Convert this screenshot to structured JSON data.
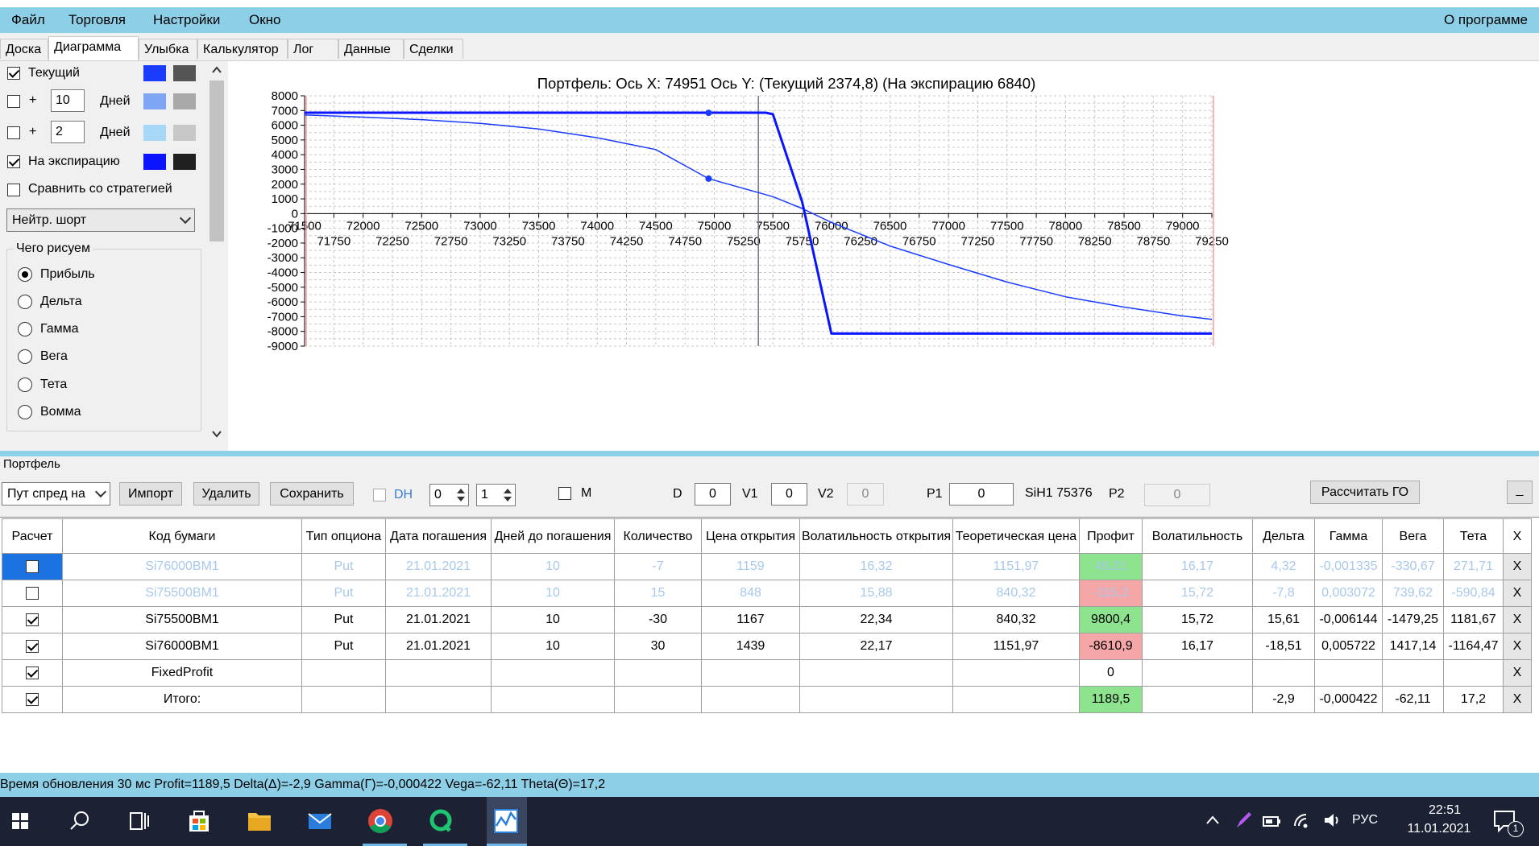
{
  "menu": {
    "items": [
      "Файл",
      "Торговля",
      "Настройки",
      "Окно"
    ],
    "about": "О программе"
  },
  "tabs": [
    "Доска",
    "Диаграмма",
    "Улыбка",
    "Калькулятор",
    "Лог",
    "Данные",
    "Сделки"
  ],
  "left_panel": {
    "current_label": "Текущий",
    "plus": "+",
    "days_label": "Дней",
    "days1": "10",
    "days2": "2",
    "expiry_label": "На экспирацию",
    "compare_label": "Сравнить со стратегией",
    "strategy_select": "Нейтр. шорт",
    "draw_group": "Чего рисуем",
    "radios": [
      "Прибыль",
      "Дельта",
      "Гамма",
      "Вега",
      "Тета",
      "Вомма"
    ],
    "colors": {
      "current_main": "#1a3cff",
      "current_alt": "#555555",
      "d10_main": "#7fa6f2",
      "d10_alt": "#a8a8a8",
      "d2_main": "#a8d8f8",
      "d2_alt": "#c8c8c8",
      "expiry_main": "#0a14ff",
      "expiry_alt": "#202020"
    }
  },
  "portfolio": {
    "section_label": "Портфель",
    "select_value": "Пут спред на",
    "import_btn": "Импорт",
    "delete_btn": "Удалить",
    "save_btn": "Сохранить",
    "dh_label": "DH",
    "spin1": "0",
    "spin2": "1",
    "m_label": "M",
    "d_label": "D",
    "d_value": "0",
    "v1_label": "V1",
    "v1_value": "0",
    "v2_label": "V2",
    "v2_value": "0",
    "p1_label": "P1",
    "p1_value": "0",
    "instrument": "SiH1 75376",
    "p2_label": "P2",
    "p2_value": "0",
    "calc_btn": "Рассчитать ГО",
    "min_btn": "_"
  },
  "table": {
    "headers": [
      "Расчет",
      "Код бумаги",
      "Тип опциона",
      "Дата погашения",
      "Дней до погашения",
      "Количество",
      "Цена открытия",
      "Волатильность открытия",
      "Теоретическая цена",
      "Профит",
      "Волатильность",
      "Дельта",
      "Гамма",
      "Вега",
      "Тета",
      "X"
    ],
    "rows": [
      {
        "check": true,
        "sel": true,
        "faded": true,
        "cells": [
          "Si76000BM1",
          "Put",
          "21.01.2021",
          "10",
          "-7",
          "1159",
          "16,32",
          "1151,97",
          "49,21",
          "16,17",
          "4,32",
          "-0,001335",
          "-330,67",
          "271,71",
          "X"
        ],
        "profit_color": "#8ee38e"
      },
      {
        "check": false,
        "sel": false,
        "faded": true,
        "cells": [
          "Si75500BM1",
          "Put",
          "21.01.2021",
          "10",
          "15",
          "848",
          "15,88",
          "840,32",
          "-115,2",
          "15,72",
          "-7,8",
          "0,003072",
          "739,62",
          "-590,84",
          "X"
        ],
        "profit_color": "#f5a6a6"
      },
      {
        "check": true,
        "sel": false,
        "faded": false,
        "cells": [
          "Si75500BM1",
          "Put",
          "21.01.2021",
          "10",
          "-30",
          "1167",
          "22,34",
          "840,32",
          "9800,4",
          "15,72",
          "15,61",
          "-0,006144",
          "-1479,25",
          "1181,67",
          "X"
        ],
        "profit_color": "#8ee38e"
      },
      {
        "check": true,
        "sel": false,
        "faded": false,
        "cells": [
          "Si76000BM1",
          "Put",
          "21.01.2021",
          "10",
          "30",
          "1439",
          "22,17",
          "1151,97",
          "-8610,9",
          "16,17",
          "-18,51",
          "0,005722",
          "1417,14",
          "-1164,47",
          "X"
        ],
        "profit_color": "#f5a6a6"
      },
      {
        "check": true,
        "sel": false,
        "faded": false,
        "cells": [
          "FixedProfit",
          "",
          "",
          "",
          "",
          "",
          "",
          "",
          "0",
          "",
          "",
          "",
          "",
          "",
          "X"
        ],
        "profit_color": "#ffffff"
      },
      {
        "check": true,
        "sel": false,
        "faded": false,
        "cells": [
          "Итого:",
          "",
          "",
          "",
          "",
          "",
          "",
          "",
          "1189,5",
          "",
          "-2,9",
          "-0,000422",
          "-62,11",
          "17,2",
          "X"
        ],
        "profit_color": "#8ee38e"
      }
    ]
  },
  "status": {
    "text": "Время обновления 30 мс  Profit=1189,5 Delta(Δ)=-2,9 Gamma(Γ)=-0,000422 Vega=-62,11 Theta(Θ)=17,2"
  },
  "taskbar": {
    "lang": "РУС",
    "time": "22:51",
    "date": "11.01.2021",
    "notif_count": "1"
  },
  "chart_data": {
    "type": "line",
    "title": "Портфель: Ось X: 74951 Ось Y:  (Текущий 2374,8)  (На экспирацию 6840)",
    "xlim": [
      71500,
      79250
    ],
    "ylim": [
      -9000,
      8000
    ],
    "x_ticks_top": [
      71500,
      72000,
      72500,
      73000,
      73500,
      74000,
      74500,
      75000,
      75500,
      76000,
      76500,
      77000,
      77500,
      78000,
      78500,
      79000
    ],
    "x_ticks_bottom": [
      71750,
      72250,
      72750,
      73250,
      73750,
      74250,
      74750,
      75250,
      75750,
      76250,
      76750,
      77250,
      77750,
      78250,
      78750,
      79250
    ],
    "y_ticks": [
      8000,
      7000,
      6000,
      5000,
      4000,
      3000,
      2000,
      1000,
      0,
      -1000,
      -2000,
      -3000,
      -4000,
      -5000,
      -6000,
      -7000,
      -8000,
      -9000
    ],
    "grid": true,
    "crosshair_x": 74951,
    "current_price_line": 75376,
    "range_lines": [
      71500,
      79250
    ],
    "series": [
      {
        "name": "Текущий",
        "color": "#1a3cff",
        "width": 1.5,
        "points": [
          [
            71500,
            6700
          ],
          [
            72000,
            6550
          ],
          [
            72500,
            6380
          ],
          [
            73000,
            6130
          ],
          [
            73500,
            5750
          ],
          [
            74000,
            5150
          ],
          [
            74500,
            4350
          ],
          [
            74951,
            2374.8
          ],
          [
            75500,
            1150
          ],
          [
            75750,
            350
          ],
          [
            76000,
            -600
          ],
          [
            76500,
            -2200
          ],
          [
            77000,
            -3450
          ],
          [
            77500,
            -4650
          ],
          [
            78000,
            -5650
          ],
          [
            78500,
            -6350
          ],
          [
            79000,
            -6950
          ],
          [
            79250,
            -7180
          ]
        ]
      },
      {
        "name": "На экспирацию",
        "color": "#0a14ff",
        "width": 3,
        "points": [
          [
            71500,
            6850
          ],
          [
            75440,
            6850
          ],
          [
            75500,
            6750
          ],
          [
            75750,
            800
          ],
          [
            76000,
            -8150
          ],
          [
            79250,
            -8150
          ]
        ]
      }
    ],
    "markers": [
      [
        74951,
        6840
      ],
      [
        74951,
        2374.8
      ]
    ]
  }
}
